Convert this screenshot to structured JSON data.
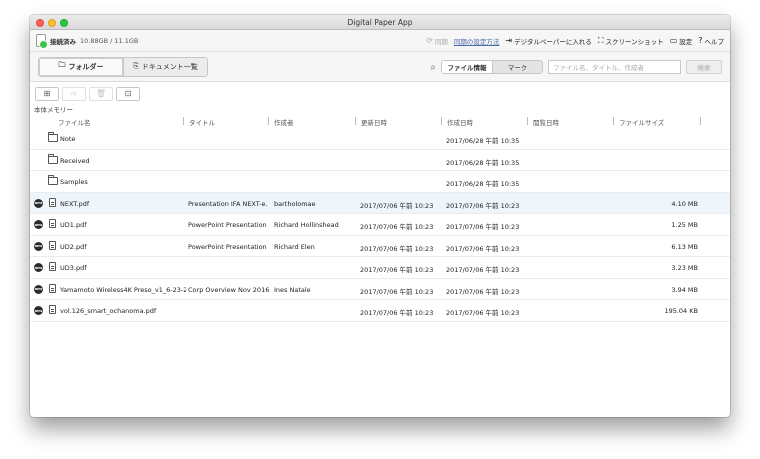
{
  "app": {
    "title": "Digital Paper App"
  },
  "status": {
    "label": "接続済み",
    "storage": "10.88GB / 11.1GB"
  },
  "topbar": {
    "sync_label": "同期",
    "sync_settings_label": "同期の設定方法",
    "add_to_paper_label": "デジタルペーパーに入れる",
    "screenshot_label": "スクリーンショット",
    "settings_label": "設定",
    "help_label": "ヘルプ"
  },
  "view_tabs": {
    "folder_label": "フォルダー",
    "documents_label": "ドキュメント一覧"
  },
  "search": {
    "file_info_label": "ファイル情報",
    "mark_label": "マーク",
    "placeholder": "ファイル名、タイトル、作成者",
    "button_label": "検索"
  },
  "section": {
    "label": "本体メモリー"
  },
  "columns": {
    "filename": "ファイル名",
    "title": "タイトル",
    "author": "作成者",
    "modified": "更新日時",
    "created": "作成日時",
    "viewed": "閲覧日時",
    "size": "ファイルサイズ"
  },
  "files": [
    {
      "type": "folder",
      "is_new": false,
      "name": "Note",
      "title": "",
      "author": "",
      "modified": "",
      "created": "2017/06/28 午前 10:35",
      "size": ""
    },
    {
      "type": "folder",
      "is_new": false,
      "name": "Received",
      "title": "",
      "author": "",
      "modified": "",
      "created": "2017/06/28 午前 10:35",
      "size": ""
    },
    {
      "type": "folder",
      "is_new": false,
      "name": "Samples",
      "title": "",
      "author": "",
      "modified": "",
      "created": "2017/06/28 午前 10:35",
      "size": ""
    },
    {
      "type": "pdf",
      "is_new": true,
      "name": "NEXT.pdf",
      "title": "Presentation IFA NEXT-e...",
      "author": "bartholomae",
      "modified": "2017/07/06 午前 10:23",
      "created": "2017/07/06 午前 10:23",
      "size": "4.10 MB"
    },
    {
      "type": "pdf",
      "is_new": true,
      "name": "UD1.pdf",
      "title": "PowerPoint Presentation",
      "author": "Richard Hollinshead",
      "modified": "2017/07/06 午前 10:23",
      "created": "2017/07/06 午前 10:23",
      "size": "1.25 MB"
    },
    {
      "type": "pdf",
      "is_new": true,
      "name": "UD2.pdf",
      "title": "PowerPoint Presentation",
      "author": "Richard Elen",
      "modified": "2017/07/06 午前 10:23",
      "created": "2017/07/06 午前 10:23",
      "size": "6.13 MB"
    },
    {
      "type": "pdf",
      "is_new": true,
      "name": "UD3.pdf",
      "title": "",
      "author": "",
      "modified": "2017/07/06 午前 10:23",
      "created": "2017/07/06 午前 10:23",
      "size": "3.23 MB"
    },
    {
      "type": "pdf",
      "is_new": true,
      "name": "Yamamoto Wireless4K Preso_v1_6-23-2...",
      "title": "Corp Overview Nov 2016 ...",
      "author": "Ines Natale",
      "modified": "2017/07/06 午前 10:23",
      "created": "2017/07/06 午前 10:23",
      "size": "3.94 MB"
    },
    {
      "type": "pdf",
      "is_new": true,
      "name": "vol.126_smart_ochanoma.pdf",
      "title": "",
      "author": "",
      "modified": "2017/07/06 午前 10:23",
      "created": "2017/07/06 午前 10:23",
      "size": "195.04 KB"
    }
  ],
  "new_badge_label": "NEW",
  "selected_row": 3
}
